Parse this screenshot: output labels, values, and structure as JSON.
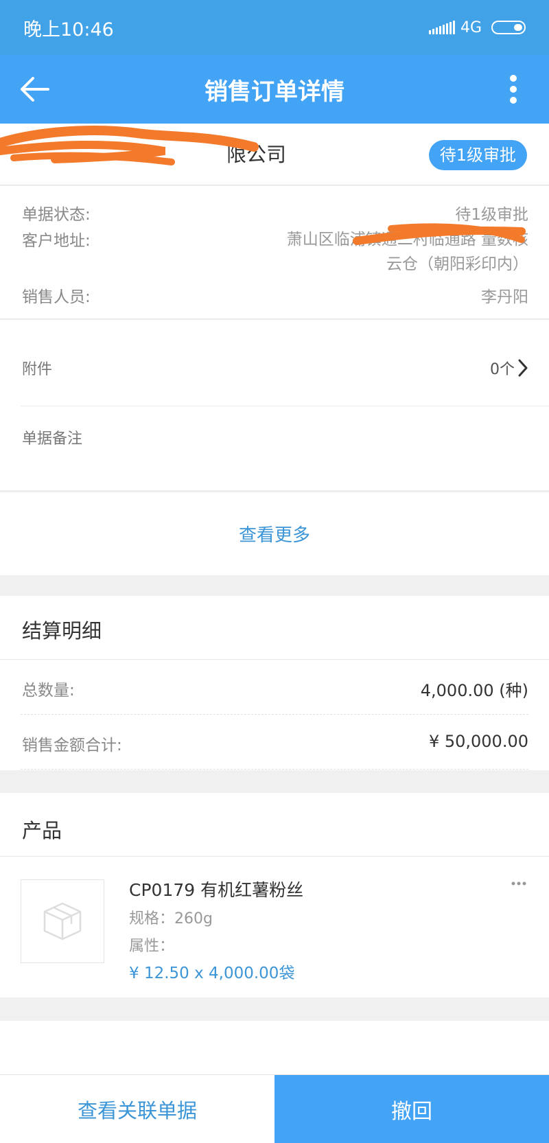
{
  "status_bar": {
    "time": "晚上10:46",
    "network": "4G"
  },
  "app_bar": {
    "title": "销售订单详情"
  },
  "order": {
    "company_suffix": "限公司",
    "status_badge": "待1级审批"
  },
  "info": {
    "status_label": "单据状态:",
    "status_value": "待1级审批",
    "address_label": "客户地址:",
    "address_line1": "萧山区临浦镇通二村临通路   量数核",
    "address_line2": "云仓（朝阳彩印内）",
    "sales_label": "销售人员:",
    "sales_value": "李丹阳"
  },
  "attachments": {
    "label": "附件",
    "count": "0个"
  },
  "remark": {
    "label": "单据备注"
  },
  "view_more": "查看更多",
  "settlement": {
    "title": "结算明细",
    "total_qty_label": "总数量:",
    "total_qty_value": "4,000.00 (种)",
    "total_amount_label": "销售金额合计:",
    "total_amount_value": "¥ 50,000.00"
  },
  "products": {
    "title": "产品",
    "items": [
      {
        "name": "CP0179 有机红薯粉丝",
        "spec": "规格：260g",
        "attr": "属性：",
        "price": "¥ 12.50 x 4,000.00袋"
      }
    ]
  },
  "bottom": {
    "related_label": "查看关联单据",
    "revoke_label": "撤回"
  },
  "colors": {
    "primary": "#43a3f5",
    "status_bar": "#42a2e8",
    "link": "#3c95d6",
    "redaction": "#f47a2b"
  }
}
